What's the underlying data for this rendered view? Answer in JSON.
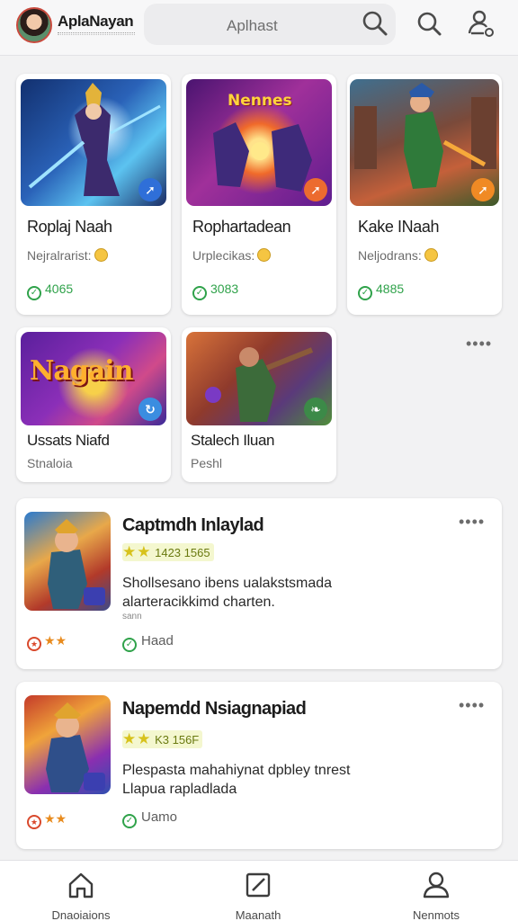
{
  "header": {
    "brand": "AplaNayan",
    "search_placeholder": "Aplhast"
  },
  "grid_cards": [
    {
      "title": "Roplaj Naah",
      "subtitle": "Nejralrarist:",
      "stat": "4065",
      "colors": [
        "#1a3f8c",
        "#3fa6e8"
      ],
      "badge_color": "#2f6fd8",
      "badge_icon": "sword-icon"
    },
    {
      "title": "Rophartadean",
      "subtitle": "Urplecikas:",
      "stat": "3083",
      "banner": "Nennes",
      "colors": [
        "#6b1e8f",
        "#f07a2a"
      ],
      "badge_color": "#ec6b2f",
      "badge_icon": "sword-icon"
    },
    {
      "title": "Kake INaah",
      "subtitle": "Neljodrans:",
      "stat": "4885",
      "colors": [
        "#2f5a3a",
        "#e0733b"
      ],
      "badge_color": "#f08a24",
      "badge_icon": "sword-icon"
    },
    {
      "title": "Ussats Niafd",
      "subtitle": "Stnaloia",
      "banner": "Nagain",
      "colors": [
        "#6a2ac0",
        "#f1a21f"
      ],
      "badge_color": "#3b8de0",
      "badge_icon": "refresh-icon"
    },
    {
      "title": "Stalech Iluan",
      "subtitle": "Peshl",
      "colors": [
        "#8f3a2c",
        "#5e8f3a"
      ],
      "badge_color": "#3c8a48",
      "badge_icon": "leaf-icon"
    }
  ],
  "feed": [
    {
      "title": "Captmdh Inlaylad",
      "rating_text": "1423 1565",
      "description": "Shollsesano ibens ualakstsmada alarteracikkimd charten.",
      "tiny": "sann",
      "meta_left": "★★",
      "meta_right": "Haad"
    },
    {
      "title": "Napemdd Nsiagnapiad",
      "rating_text": "K3 156F",
      "description": "Plespasta mahahiynat dpbley tnrest Llapua rapladlada",
      "meta_left": "★★",
      "meta_right": "Uamo"
    }
  ],
  "nav": [
    {
      "label": "Dnaoiaions",
      "icon": "home-icon"
    },
    {
      "label": "Maanath",
      "icon": "edit-icon"
    },
    {
      "label": "Nenmots",
      "icon": "profile-icon"
    }
  ]
}
